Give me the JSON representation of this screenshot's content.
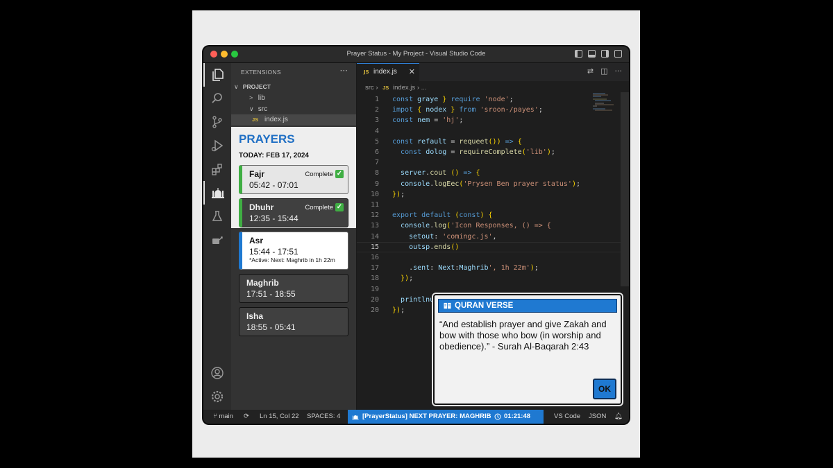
{
  "window": {
    "title": "Prayer Status - My Project - Visual Studio Code"
  },
  "sidebar": {
    "header": "EXTENSIONS",
    "more": "···",
    "tree": [
      {
        "label": "PROJECT",
        "chevron": "∨",
        "indent": 0
      },
      {
        "label": "lib",
        "chevron": ">",
        "indent": 1
      },
      {
        "label": "src",
        "chevron": "∨",
        "indent": 1
      },
      {
        "label": "index.js",
        "badge": "JS",
        "indent": 2
      }
    ]
  },
  "prayers": {
    "title": "PRAYERS",
    "today": "TODAY: FEB 17, 2024",
    "items": [
      {
        "name": "Fajr",
        "time": "05:42 - 07:01",
        "status": "Complete"
      },
      {
        "name": "Dhuhr",
        "time": "12:35 - 15:44",
        "status": "Complete"
      },
      {
        "name": "Asr",
        "time": "15:44 - 17:51",
        "note": "*Active: Next: Maghrib in 1h 22m"
      },
      {
        "name": "Maghrib",
        "time": "17:51 - 18:55"
      },
      {
        "name": "Isha",
        "time": "18:55 - 05:41"
      }
    ]
  },
  "editor": {
    "tab": {
      "badge": "JS",
      "label": "index.js",
      "close": "✕"
    },
    "breadcrumb": {
      "folder": "src",
      "sep": "›",
      "badge": "JS",
      "file": "index.js",
      "tail": "›  ..."
    },
    "current_line": 15,
    "lines": [
      {
        "n": "1",
        "code": "const graye } require 'node';"
      },
      {
        "n": "2",
        "code": "impot { nodex } from 'sroon-/payes';"
      },
      {
        "n": "3",
        "code": "const nem = 'hj';"
      },
      {
        "n": "4",
        "code": ""
      },
      {
        "n": "5",
        "code": "const refault = requeet()) => {"
      },
      {
        "n": "6",
        "code": "  const dolog = requireComplete('lib');"
      },
      {
        "n": "7",
        "code": ""
      },
      {
        "n": "8",
        "code": "  server.cout () => {"
      },
      {
        "n": "9",
        "code": "  console.logEec('Prysen Ben prayer status');"
      },
      {
        "n": "10",
        "code": "});"
      },
      {
        "n": "11",
        "code": ""
      },
      {
        "n": "12",
        "code": "export default (const) {"
      },
      {
        "n": "13",
        "code": "  console.log('Icon Responses, () => {"
      },
      {
        "n": "14",
        "code": "    setout: 'comingc.js',"
      },
      {
        "n": "15",
        "code": "    outsp.ends()"
      },
      {
        "n": "16",
        "code": ""
      },
      {
        "n": "17",
        "code": "    .sent: Next:Maghrib', 1h 22m');"
      },
      {
        "n": "18",
        "code": "  });"
      },
      {
        "n": "19",
        "code": ""
      },
      {
        "n": "20",
        "code": "  printlnu"
      },
      {
        "n": "20",
        "code": "});"
      }
    ]
  },
  "statusbar": {
    "branch": "main",
    "position": "Ln 15, Col 22",
    "spaces": "SPACES: 4",
    "center": "[PrayerStatus] NEXT PRAYER: MAGHRIB",
    "timer": "01:21:48",
    "app": "VS Code",
    "lang": "JSON"
  },
  "dialog": {
    "title": "QURAN VERSE",
    "body": "“And establish prayer and give Zakah and bow with those who bow (in worship and obedience).” - Surah Al-Baqarah 2:43",
    "ok": "OK"
  },
  "colors": {
    "accent_blue": "#1f79d1",
    "complete_green": "#3fae43",
    "active_blue": "#1f6fc4"
  }
}
